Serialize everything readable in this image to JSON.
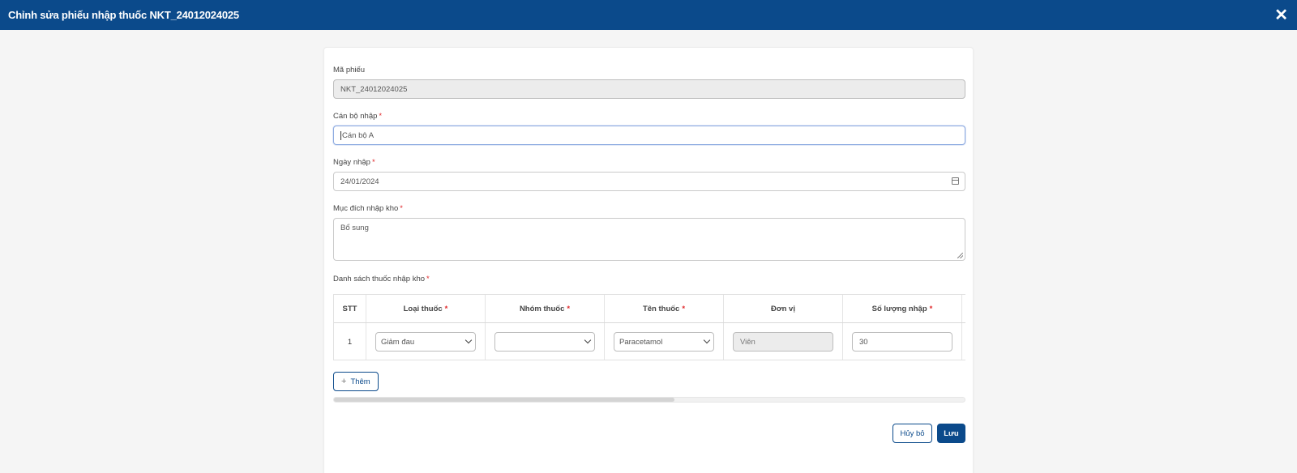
{
  "header": {
    "title": "Chỉnh sửa phiếu nhập thuốc NKT_24012024025",
    "close_symbol": "✕"
  },
  "form": {
    "ma_phieu": {
      "label": "Mã phiếu",
      "value": "NKT_24012024025"
    },
    "can_bo": {
      "label": "Cán bộ nhập",
      "required": "*",
      "value": "Cán bộ A"
    },
    "ngay_nhap": {
      "label": "Ngày nhập",
      "required": "*",
      "value": "24/01/2024"
    },
    "muc_dich": {
      "label": "Mục đích nhập kho",
      "required": "*",
      "value": "Bổ sung"
    },
    "danh_sach": {
      "label": "Danh sách thuốc nhập kho",
      "required": "*"
    }
  },
  "table": {
    "required": "*",
    "headers": {
      "stt": "STT",
      "loai": "Loại thuốc",
      "nhom": "Nhóm thuốc",
      "ten": "Tên thuốc",
      "don_vi": "Đơn vị",
      "so_luong": "Số lượng nhập"
    },
    "rows": [
      {
        "stt": "1",
        "loai": "Giảm đau",
        "nhom": "",
        "ten": "Paracetamol",
        "don_vi": "Viên",
        "so_luong": "30"
      }
    ]
  },
  "scroll": {
    "position_fraction": 0.54
  },
  "buttons": {
    "add_plus": "+",
    "add": "Thêm",
    "cancel": "Hủy bỏ",
    "save": "Lưu"
  },
  "colors": {
    "primary": "#0b4a8b",
    "required": "#e0292b",
    "focus_border": "#8ba9e0"
  }
}
